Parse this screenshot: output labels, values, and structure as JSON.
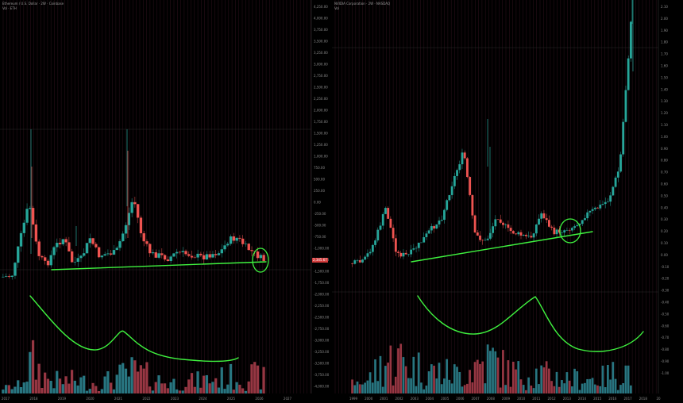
{
  "colors": {
    "background": "#000000",
    "grid_vertical": "#4a1a2e",
    "candle_up": "#26a69a",
    "candle_down": "#ef5350",
    "volume_up": "#2e8a96",
    "volume_down": "#b0404e",
    "annotation": "#3ff23f",
    "last_price_badge": "#d13b3b"
  },
  "left_pane": {
    "header": {
      "title": "Ethereum / U.S. Dollar · 2W · Coinbase",
      "subline": "Vol · ETH"
    },
    "price_axis_labels": [
      "4,250.00",
      "4,000.00",
      "3,750.00",
      "3,500.00",
      "3,250.00",
      "3,000.00",
      "2,750.00",
      "2,500.00",
      "2,250.00",
      "2,000.00",
      "1,750.00",
      "1,500.00",
      "1,250.00",
      "1,000.00",
      "750.00",
      "500.00",
      "250.00",
      "0.00",
      "-250.00",
      "-500.00",
      "-750.00",
      "-1,000.00",
      "-1,250.00",
      "-1,500.00",
      "-1,750.00",
      "-2,000.00",
      "-2,250.00",
      "-2,500.00",
      "-2,750.00",
      "-3,000.00",
      "-3,250.00",
      "-3,500.00",
      "-3,750.00",
      "-4,000.00",
      "-4,250.00"
    ],
    "x_axis_labels": [
      "2017",
      "2018",
      "2019",
      "2020",
      "2021",
      "2022",
      "2023",
      "2024",
      "2025",
      "2026",
      "2027"
    ],
    "last_price": "2,345.67"
  },
  "right_pane": {
    "header": {
      "title": "NVIDIA Corporation · 2W · NASDAQ",
      "subline": "Vol"
    },
    "price_axis_labels": [
      "2.10",
      "2.00",
      "1.90",
      "1.80",
      "1.70",
      "1.60",
      "1.50",
      "1.40",
      "1.30",
      "1.20",
      "1.10",
      "1.00",
      "0.90",
      "0.80",
      "0.70",
      "0.60",
      "0.50",
      "0.40",
      "0.30",
      "0.20",
      "0.10",
      "0.00",
      "-0.10",
      "-0.20",
      "-0.30",
      "-0.40",
      "-0.50",
      "-0.60",
      "-0.70",
      "-0.80",
      "-0.90",
      "-1.00"
    ],
    "x_axis_labels": [
      "1999",
      "2000",
      "2001",
      "2002",
      "2003",
      "2004",
      "2005",
      "2006",
      "2007",
      "2008",
      "2009",
      "2010",
      "2011",
      "2012",
      "2013",
      "2014",
      "2015",
      "2016",
      "2017",
      "2018",
      "20"
    ]
  },
  "chart_data": [
    {
      "type": "candlestick",
      "title": "Ethereum / U.S. Dollar · 2W · Coinbase",
      "x": [
        "2017",
        "2017.5",
        "2018",
        "2018.5",
        "2019",
        "2019.5",
        "2020",
        "2020.5",
        "2021",
        "2021.5",
        "2022",
        "2022.5",
        "2023",
        "2023.5",
        "2024",
        "2024.5",
        "2025",
        "2025.5",
        "2026"
      ],
      "close": [
        10,
        250,
        1200,
        450,
        140,
        250,
        200,
        300,
        1400,
        3500,
        2000,
        1200,
        1600,
        1750,
        2300,
        3000,
        2600,
        2900,
        2350
      ],
      "ylim": [
        -4250,
        4250
      ],
      "annotations": [
        "support trendline",
        "circle at latest candle",
        "volume rounding curve"
      ]
    },
    {
      "type": "candlestick",
      "title": "NVIDIA Corporation · 2W · NASDAQ",
      "x": [
        "1999",
        "2000",
        "2001",
        "2002",
        "2003",
        "2004",
        "2005",
        "2006",
        "2007",
        "2008",
        "2009",
        "2010",
        "2011",
        "2012",
        "2013",
        "2014",
        "2015",
        "2016",
        "2017"
      ],
      "close": [
        0.03,
        0.1,
        0.2,
        0.4,
        0.08,
        0.15,
        0.3,
        0.6,
        0.9,
        0.2,
        0.35,
        0.45,
        0.3,
        0.25,
        0.3,
        0.38,
        0.5,
        0.8,
        2.1
      ],
      "ylim": [
        -1.0,
        2.1
      ],
      "annotations": [
        "support trendline",
        "circle at 2013 consolidation",
        "volume double rounding curve"
      ]
    }
  ]
}
